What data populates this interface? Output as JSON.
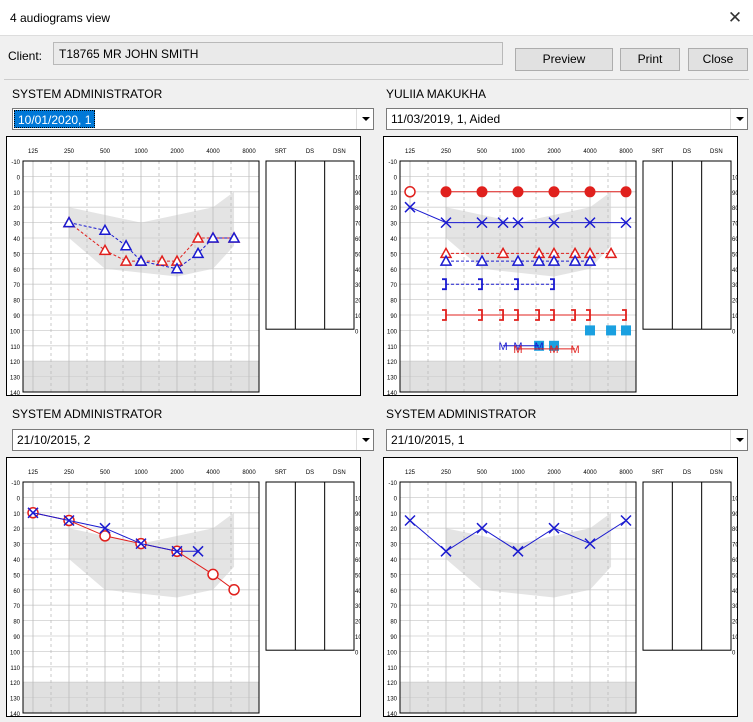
{
  "window": {
    "title": "4 audiograms view"
  },
  "toolbar": {
    "client_label": "Client:",
    "client_value": "T18765  MR JOHN SMITH",
    "preview_label": "Preview",
    "print_label": "Print",
    "close_label": "Close"
  },
  "chart_axis": {
    "freq_labels": [
      "125",
      "250",
      "500",
      "1000",
      "2000",
      "4000",
      "8000"
    ],
    "db_labels": [
      "-10",
      "0",
      "10",
      "20",
      "30",
      "40",
      "50",
      "60",
      "70",
      "80",
      "90",
      "100",
      "110",
      "120",
      "130",
      "140"
    ],
    "score_headers": [
      "SRT",
      "DS",
      "DSN"
    ],
    "pct_labels": [
      "100",
      "90",
      "80",
      "70",
      "60",
      "50",
      "40",
      "30",
      "20",
      "10",
      "0"
    ]
  },
  "colors": {
    "right_ear": "#e0201d",
    "left_ear": "#1a1ad0",
    "aided_fill": "#1aa0e0",
    "speech_banana": "#e4e4e4"
  },
  "panels": [
    {
      "user": "SYSTEM ADMINISTRATOR",
      "session": "10/01/2020, 1",
      "selected": true
    },
    {
      "user": "YULIIA MAKUKHA",
      "session": "11/03/2019, 1, Aided",
      "selected": false
    },
    {
      "user": "SYSTEM ADMINISTRATOR",
      "session": "21/10/2015, 2",
      "selected": false
    },
    {
      "user": "SYSTEM ADMINISTRATOR",
      "session": "21/10/2015, 1",
      "selected": false
    }
  ],
  "chart_data": [
    {
      "type": "scatter",
      "x_unit": "Hz",
      "y_unit": "dB HL",
      "ylim": [
        -10,
        140
      ],
      "series": [
        {
          "marker": "triangle",
          "ear": "right",
          "color": "#e0201d",
          "dash": true,
          "points": [
            [
              250,
              30
            ],
            [
              500,
              48
            ],
            [
              750,
              55
            ],
            [
              1000,
              55
            ],
            [
              1500,
              55
            ],
            [
              2000,
              55
            ],
            [
              3000,
              40
            ],
            [
              4000,
              40
            ],
            [
              6000,
              40
            ]
          ]
        },
        {
          "marker": "triangle",
          "ear": "left",
          "color": "#1a1ad0",
          "dash": true,
          "points": [
            [
              250,
              30
            ],
            [
              500,
              35
            ],
            [
              750,
              45
            ],
            [
              1000,
              55
            ],
            [
              2000,
              60
            ],
            [
              3000,
              50
            ],
            [
              4000,
              40
            ],
            [
              6000,
              40
            ]
          ]
        }
      ]
    },
    {
      "type": "scatter",
      "x_unit": "Hz",
      "y_unit": "dB HL",
      "ylim": [
        -10,
        140
      ],
      "series": [
        {
          "marker": "circle-open",
          "ear": "right",
          "color": "#e0201d",
          "dash": true,
          "points": [
            [
              125,
              10
            ]
          ]
        },
        {
          "marker": "circle-filled",
          "ear": "right",
          "color": "#e0201d",
          "dash": false,
          "points": [
            [
              250,
              10
            ],
            [
              500,
              10
            ],
            [
              1000,
              10
            ],
            [
              2000,
              10
            ],
            [
              4000,
              10
            ],
            [
              8000,
              10
            ]
          ]
        },
        {
          "marker": "cross",
          "ear": "left",
          "color": "#1a1ad0",
          "dash": false,
          "points": [
            [
              125,
              20
            ],
            [
              250,
              30
            ],
            [
              500,
              30
            ],
            [
              750,
              30
            ],
            [
              1000,
              30
            ],
            [
              2000,
              30
            ],
            [
              4000,
              30
            ],
            [
              8000,
              30
            ]
          ]
        },
        {
          "marker": "triangle",
          "ear": "right",
          "color": "#e0201d",
          "dash": true,
          "points": [
            [
              250,
              50
            ],
            [
              750,
              50
            ],
            [
              1500,
              50
            ],
            [
              2000,
              50
            ],
            [
              3000,
              50
            ],
            [
              4000,
              50
            ],
            [
              6000,
              50
            ]
          ]
        },
        {
          "marker": "triangle",
          "ear": "left",
          "color": "#1a1ad0",
          "dash": true,
          "points": [
            [
              250,
              55
            ],
            [
              500,
              55
            ],
            [
              1000,
              55
            ],
            [
              1500,
              55
            ],
            [
              2000,
              55
            ],
            [
              3000,
              55
            ],
            [
              4000,
              55
            ]
          ]
        },
        {
          "marker": "bracket",
          "ear": "left",
          "color": "#1a1ad0",
          "dash": true,
          "points": [
            [
              250,
              70
            ],
            [
              500,
              70
            ],
            [
              1000,
              70
            ],
            [
              2000,
              70
            ]
          ]
        },
        {
          "marker": "bracket",
          "ear": "right",
          "color": "#e0201d",
          "dash": false,
          "points": [
            [
              250,
              90
            ],
            [
              500,
              90
            ],
            [
              750,
              90
            ],
            [
              1000,
              90
            ],
            [
              1500,
              90
            ],
            [
              2000,
              90
            ],
            [
              3000,
              90
            ],
            [
              4000,
              90
            ],
            [
              8000,
              90
            ]
          ]
        },
        {
          "marker": "square-filled",
          "ear": "left",
          "color": "#1aa0e0",
          "dash": false,
          "points": [
            [
              4000,
              100
            ],
            [
              6000,
              100
            ],
            [
              8000,
              100
            ],
            [
              1500,
              110
            ],
            [
              2000,
              110
            ]
          ]
        },
        {
          "marker": "M",
          "ear": "left",
          "color": "#1a1ad0",
          "dash": false,
          "points": [
            [
              750,
              110
            ],
            [
              1000,
              110
            ],
            [
              1500,
              110
            ]
          ]
        },
        {
          "marker": "M",
          "ear": "right",
          "color": "#e0201d",
          "dash": false,
          "points": [
            [
              1000,
              112
            ],
            [
              2000,
              112
            ],
            [
              3000,
              112
            ]
          ]
        }
      ]
    },
    {
      "type": "scatter",
      "x_unit": "Hz",
      "y_unit": "dB HL",
      "ylim": [
        -10,
        140
      ],
      "series": [
        {
          "marker": "circle-open",
          "ear": "right",
          "color": "#e0201d",
          "dash": false,
          "points": [
            [
              125,
              10
            ],
            [
              250,
              15
            ],
            [
              500,
              25
            ],
            [
              1000,
              30
            ],
            [
              2000,
              35
            ],
            [
              4000,
              50
            ],
            [
              6000,
              60
            ]
          ]
        },
        {
          "marker": "cross",
          "ear": "left",
          "color": "#1a1ad0",
          "dash": false,
          "points": [
            [
              125,
              10
            ],
            [
              250,
              15
            ],
            [
              500,
              20
            ],
            [
              1000,
              30
            ],
            [
              2000,
              35
            ],
            [
              3000,
              35
            ]
          ]
        }
      ]
    },
    {
      "type": "scatter",
      "x_unit": "Hz",
      "y_unit": "dB HL",
      "ylim": [
        -10,
        140
      ],
      "series": [
        {
          "marker": "cross",
          "ear": "left",
          "color": "#1a1ad0",
          "dash": false,
          "points": [
            [
              125,
              15
            ],
            [
              250,
              35
            ],
            [
              500,
              20
            ],
            [
              1000,
              35
            ],
            [
              2000,
              20
            ],
            [
              4000,
              30
            ],
            [
              8000,
              15
            ]
          ]
        }
      ]
    }
  ]
}
